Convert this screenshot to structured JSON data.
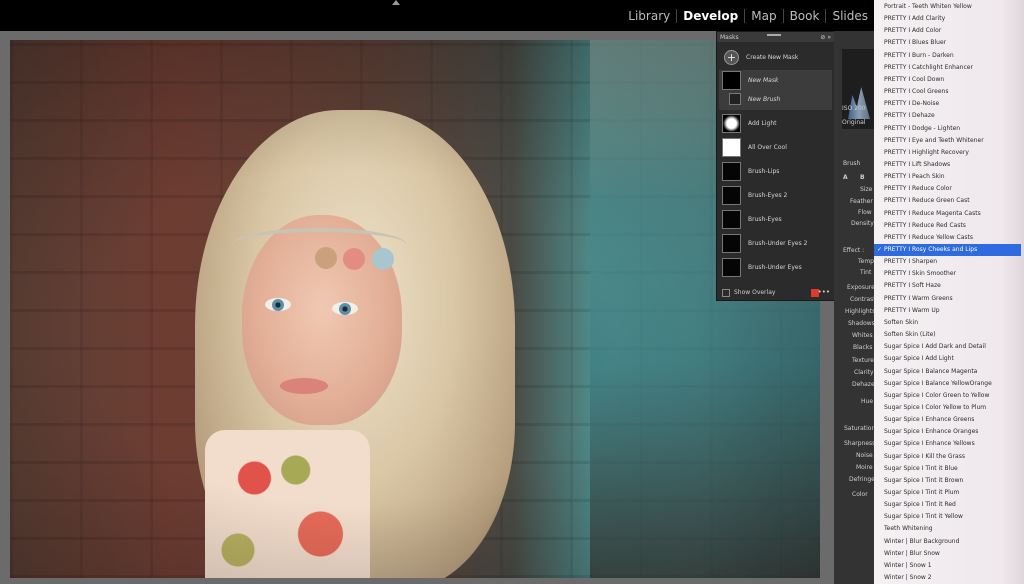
{
  "topbar": {
    "modules": [
      "Library",
      "Develop",
      "Map",
      "Book",
      "Slides"
    ],
    "active": "Develop"
  },
  "masks": {
    "title": "Masks",
    "create_label": "Create New Mask",
    "rows": [
      {
        "label": "New Mask"
      },
      {
        "label": "New Brush"
      },
      {
        "label": "Add Light"
      },
      {
        "label": "All Over Cool"
      },
      {
        "label": "Brush-Lips"
      },
      {
        "label": "Brush-Eyes 2"
      },
      {
        "label": "Brush-Eyes"
      },
      {
        "label": "Brush-Under Eyes 2"
      },
      {
        "label": "Brush-Under Eyes"
      }
    ],
    "show_overlay_label": "Show Overlay",
    "overlay_color": "#e03a2a"
  },
  "right_panel": {
    "iso": "ISO 200",
    "original": "Original",
    "brush_label": "Brush",
    "ab": [
      "A",
      "B"
    ],
    "size": "Size",
    "feather": "Feather",
    "flow": "Flow",
    "density": "Density",
    "effect": "Effect :",
    "temp": "Temp",
    "tint": "Tint",
    "exposure": "Exposure",
    "contrast": "Contrast",
    "highlights": "Highlights",
    "shadows": "Shadows",
    "whites": "Whites",
    "blacks": "Blacks",
    "texture": "Texture",
    "clarity": "Clarity",
    "dehaze": "Dehaze",
    "hue": "Hue",
    "saturation": "Saturation",
    "sharpness": "Sharpness",
    "noise": "Noise",
    "moire": "Moire",
    "defringe": "Defringe",
    "color": "Color"
  },
  "preset_menu": {
    "selected_index": 20,
    "items": [
      "Portrait - Teeth Whiten Yellow",
      "PRETTY I Add Clarity",
      "PRETTY I Add Color",
      "PRETTY I Blues Bluer",
      "PRETTY I Burn - Darken",
      "PRETTY I Catchlight Enhancer",
      "PRETTY I Cool Down",
      "PRETTY I Cool Greens",
      "PRETTY I De-Noise",
      "PRETTY I Dehaze",
      "PRETTY I Dodge - Lighten",
      "PRETTY I Eye and Teeth Whitener",
      "PRETTY I Highlight Recovery",
      "PRETTY I Lift Shadows",
      "PRETTY I Peach Skin",
      "PRETTY I Reduce Color",
      "PRETTY I Reduce Green Cast",
      "PRETTY I Reduce Magenta Casts",
      "PRETTY I Reduce Red Casts",
      "PRETTY I Reduce Yellow Casts",
      "PRETTY I Rosy Cheeks and Lips",
      "PRETTY I Sharpen",
      "PRETTY I Skin Smoother",
      "PRETTY I Soft Haze",
      "PRETTY I Warm Greens",
      "PRETTY I Warm Up",
      "Soften Skin",
      "Soften Skin (Lite)",
      "Sugar Spice I Add Dark and Detail",
      "Sugar Spice I Add Light",
      "Sugar Spice I Balance Magenta",
      "Sugar Spice I Balance YellowOrange",
      "Sugar Spice I Color Green to Yellow",
      "Sugar Spice I Color Yellow to Plum",
      "Sugar Spice I Enhance Greens",
      "Sugar Spice I Enhance Oranges",
      "Sugar Spice I Enhance Yellows",
      "Sugar Spice I Kill the Grass",
      "Sugar Spice I Tint it Blue",
      "Sugar Spice I Tint it Brown",
      "Sugar Spice I Tint it Plum",
      "Sugar Spice I Tint it Red",
      "Sugar Spice I Tint it Yellow",
      "Teeth Whitening",
      "Winter | Blur Background",
      "Winter | Blur Snow",
      "Winter | Snow 1",
      "Winter | Snow 2"
    ]
  }
}
